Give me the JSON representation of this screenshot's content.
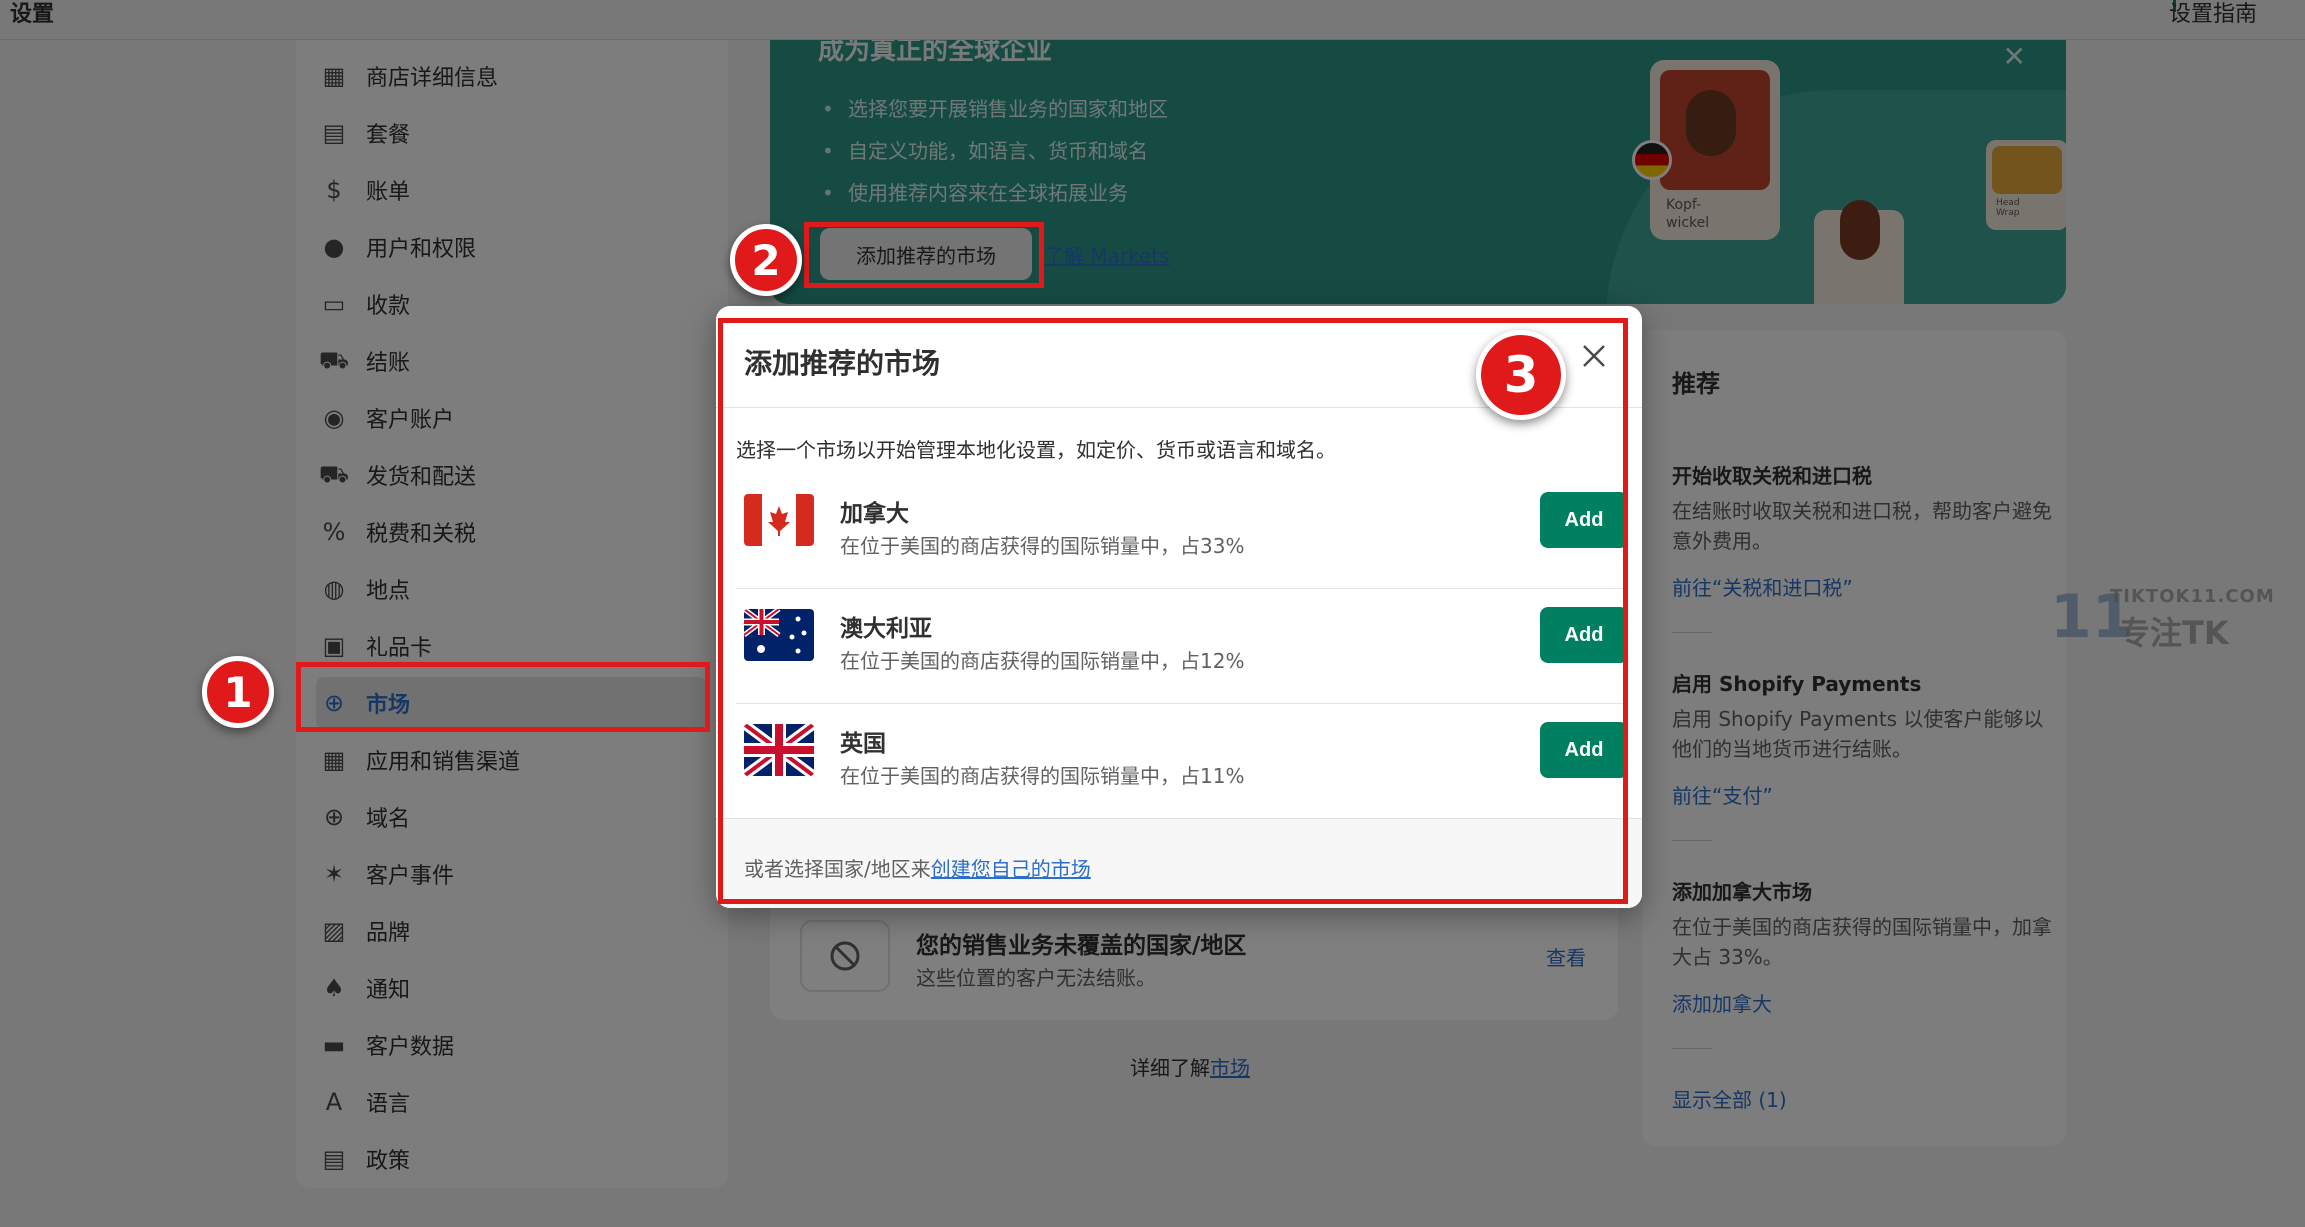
{
  "topbar": {
    "title": "设置",
    "guide": "设置指南"
  },
  "sidebar": {
    "items": [
      {
        "label": "商店详细信息",
        "icon": "store-icon"
      },
      {
        "label": "套餐",
        "icon": "plan-icon"
      },
      {
        "label": "账单",
        "icon": "billing-icon"
      },
      {
        "label": "用户和权限",
        "icon": "user-icon"
      },
      {
        "label": "收款",
        "icon": "payments-icon"
      },
      {
        "label": "结账",
        "icon": "cart-icon"
      },
      {
        "label": "客户账户",
        "icon": "customer-icon"
      },
      {
        "label": "发货和配送",
        "icon": "truck-icon"
      },
      {
        "label": "税费和关税",
        "icon": "tax-icon"
      },
      {
        "label": "地点",
        "icon": "location-icon"
      },
      {
        "label": "礼品卡",
        "icon": "gift-icon"
      },
      {
        "label": "市场",
        "icon": "globe-icon",
        "active": true
      },
      {
        "label": "应用和销售渠道",
        "icon": "apps-icon"
      },
      {
        "label": "域名",
        "icon": "domain-icon"
      },
      {
        "label": "客户事件",
        "icon": "events-icon"
      },
      {
        "label": "品牌",
        "icon": "brand-icon"
      },
      {
        "label": "通知",
        "icon": "bell-icon"
      },
      {
        "label": "客户数据",
        "icon": "data-icon"
      },
      {
        "label": "语言",
        "icon": "language-icon"
      },
      {
        "label": "政策",
        "icon": "policy-icon"
      }
    ]
  },
  "banner": {
    "title": "成为真正的全球企业",
    "bullets": [
      "选择您要开展销售业务的国家和地区",
      "自定义功能，如语言、货币和域名",
      "使用推荐内容来在全球拓展业务"
    ],
    "primary": "添加推荐的市场",
    "link": "了解 Markets",
    "card_caption": "Kopf-\nwickel",
    "small_caption": "Head\nWrap"
  },
  "uncovered": {
    "title": "您的销售业务未覆盖的国家/地区",
    "subtitle": "这些位置的客户无法结账。",
    "action": "查看"
  },
  "learn_more": {
    "prefix": "详细了解",
    "link": "市场"
  },
  "recommend": {
    "heading": "推荐",
    "items": [
      {
        "title": "开始收取关税和进口税",
        "desc": "在结账时收取关税和进口税，帮助客户避免意外费用。",
        "link": "前往“关税和进口税”"
      },
      {
        "title": "启用 Shopify Payments",
        "desc": "启用 Shopify Payments 以使客户能够以他们的当地货币进行结账。",
        "link": "前往“支付”"
      },
      {
        "title": "添加加拿大市场",
        "desc": "在位于美国的商店获得的国际销量中，加拿大占 33%。",
        "link": "添加加拿大"
      }
    ],
    "show_all": "显示全部 (1)"
  },
  "watermark": {
    "top": "TIKTOK11.COM",
    "cn": "专注TK",
    "num": "11",
    "tiny": "TIKTOK"
  },
  "modal": {
    "title": "添加推荐的市场",
    "description": "选择一个市场以开始管理本地化设置，如定价、货币或语言和域名。",
    "markets": [
      {
        "name": "加拿大",
        "desc": "在位于美国的商店获得的国际销量中，占33%",
        "button": "Add",
        "flag": "canada-flag-icon"
      },
      {
        "name": "澳大利亚",
        "desc": "在位于美国的商店获得的国际销量中，占12%",
        "button": "Add",
        "flag": "australia-flag-icon"
      },
      {
        "name": "英国",
        "desc": "在位于美国的商店获得的国际销量中，占11%",
        "button": "Add",
        "flag": "uk-flag-icon"
      }
    ],
    "footer_prefix": "或者选择国家/地区来",
    "footer_link": "创建您自己的市场"
  },
  "annotations": {
    "badge1": "1",
    "badge2": "2",
    "badge3": "3",
    "highlight_color": "#e01a1a"
  },
  "colors": {
    "primary_green": "#008060",
    "link_blue": "#2c6ecb",
    "banner_teal": "#2a9787"
  }
}
